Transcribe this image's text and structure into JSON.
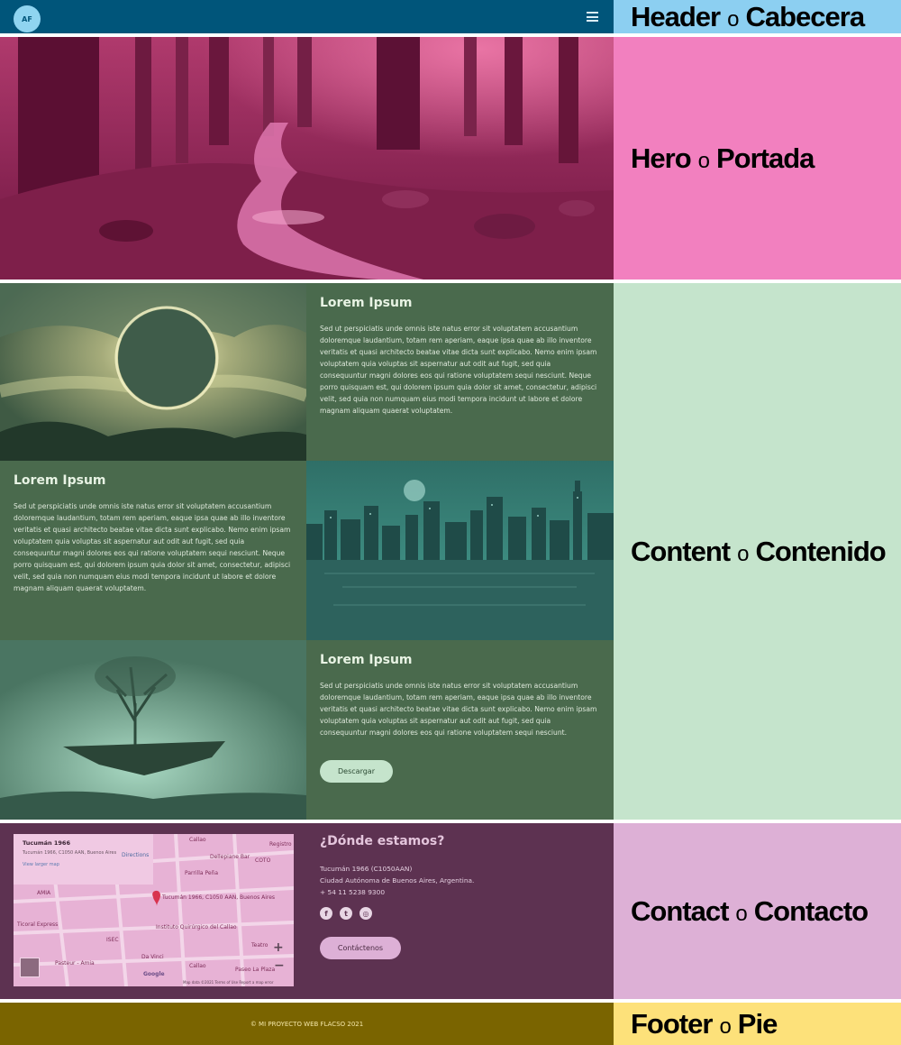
{
  "header": {
    "avatar_initials": "AF",
    "menu_icon": "hamburger-menu-icon",
    "background_color": "#00557a"
  },
  "annotations": {
    "header": {
      "name": "Header",
      "connector": "o",
      "translation": "Cabecera",
      "color": "#8ccff1"
    },
    "hero": {
      "name": "Hero",
      "connector": "o",
      "translation": "Portada",
      "color": "#f280bf"
    },
    "content": {
      "name": "Content",
      "connector": "o",
      "translation": "Contenido",
      "color": "#c5e4cc"
    },
    "contact": {
      "name": "Contact",
      "connector": "o",
      "translation": "Contacto",
      "color": "#ddb0d6"
    },
    "footer": {
      "name": "Footer",
      "connector": "o",
      "translation": "Pie",
      "color": "#fde17a"
    }
  },
  "hero": {
    "image": "forest-stream-image",
    "tint_color": "#8c1e4e"
  },
  "content": {
    "blocks": [
      {
        "title": "Lorem Ipsum",
        "text": "Sed ut perspiciatis unde omnis iste natus error sit voluptatem accusantium doloremque laudantium, totam rem aperiam, eaque ipsa quae ab illo inventore veritatis et quasi architecto beatae vitae dicta sunt explicabo. Nemo enim ipsam voluptatem quia voluptas sit aspernatur aut odit aut fugit, sed quia consequuntur magni dolores eos qui ratione voluptatem sequi nesciunt. Neque porro quisquam est, qui dolorem ipsum quia dolor sit amet, consectetur, adipisci velit, sed quia non numquam eius modi tempora incidunt ut labore et dolore magnam aliquam quaerat voluptatem.",
        "image": "eclipse-image"
      },
      {
        "title": "Lorem Ipsum",
        "text": "Sed ut perspiciatis unde omnis iste natus error sit voluptatem accusantium doloremque laudantium, totam rem aperiam, eaque ipsa quae ab illo inventore veritatis et quasi architecto beatae vitae dicta sunt explicabo. Nemo enim ipsam voluptatem quia voluptas sit aspernatur aut odit aut fugit, sed quia consequuntur magni dolores eos qui ratione voluptatem sequi nesciunt. Neque porro quisquam est, qui dolorem ipsum quia dolor sit amet, consectetur, adipisci velit, sed quia non numquam eius modi tempora incidunt ut labore et dolore magnam aliquam quaerat voluptatem.",
        "image": "city-skyline-image"
      },
      {
        "title": "Lorem Ipsum",
        "text": "Sed ut perspiciatis unde omnis iste natus error sit voluptatem accusantium doloremque laudantium, totam rem aperiam, eaque ipsa quae ab illo inventore veritatis et quasi architecto beatae vitae dicta sunt explicabo. Nemo enim ipsam voluptatem quia voluptas sit aspernatur aut odit aut fugit, sed quia consequuntur magni dolores eos qui ratione voluptatem sequi nesciunt.",
        "image": "floating-island-tree-image",
        "button_label": "Descargar"
      }
    ]
  },
  "contact": {
    "title": "¿Dónde estamos?",
    "address_line1": "Tucumán 1966 (C1050AAN)",
    "address_line2": "Ciudad Autónoma de Buenos Aires, Argentina.",
    "phone": "+ 54 11 5238 9300",
    "social_icons": [
      "facebook-icon",
      "twitter-icon",
      "instagram-icon"
    ],
    "button_label": "Contáctenos",
    "map": {
      "card_title": "Tucumán 1966",
      "card_address": "Tucumán 1966, C1050 AAN, Buenos Aires",
      "card_link": "View larger map",
      "directions": "Directions",
      "pin_label": "Tucumán 1966, C1050 AAN, Buenos Aires",
      "places": [
        "Callao",
        "Dellepiane Bar",
        "COTO",
        "Parrilla Peña",
        "AMIA",
        "Ticoral Express",
        "Instituto Quirúrgico del Callao",
        "ISEC",
        "Da Vinci",
        "Teatro",
        "Pasteur - Amia",
        "Callao",
        "Paseo La Plaza",
        "Registro"
      ],
      "attribution": "Map data ©2021   Terms of Use   Report a map error",
      "google": "Google"
    }
  },
  "footer": {
    "text": "© MI PROYECTO WEB FLACSO 2021"
  }
}
